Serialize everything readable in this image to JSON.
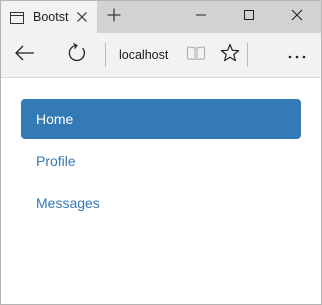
{
  "browser": {
    "tab": {
      "title": "Bootst",
      "close_icon": "close-icon",
      "page_icon": "page-icon"
    },
    "new_tab_icon": "plus-icon",
    "window_controls": [
      "minimize-icon",
      "maximize-icon",
      "close-icon"
    ],
    "address": "localhost",
    "toolbar_icons": [
      "back-arrow-icon",
      "refresh-icon",
      "reading-view-icon",
      "favorite-star-icon",
      "more-icon"
    ]
  },
  "page": {
    "nav": {
      "items": [
        {
          "label": "Home",
          "active": true
        },
        {
          "label": "Profile",
          "active": false
        },
        {
          "label": "Messages",
          "active": false
        }
      ]
    }
  },
  "colors": {
    "accent": "#337ab7",
    "active_text": "#ffffff",
    "titlebar": "#d2d2d2",
    "toolbar": "#f2f2f2"
  }
}
